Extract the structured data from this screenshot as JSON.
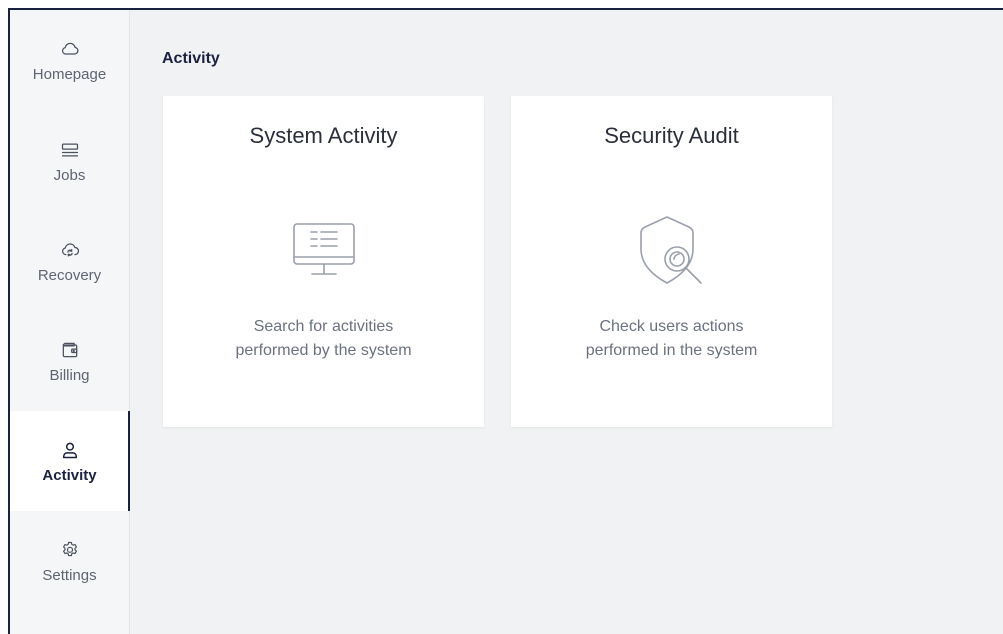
{
  "sidebar": {
    "items": [
      {
        "label": "Homepage",
        "icon": "cloud-icon"
      },
      {
        "label": "Jobs",
        "icon": "list-icon"
      },
      {
        "label": "Recovery",
        "icon": "cloud-refresh-icon"
      },
      {
        "label": "Billing",
        "icon": "wallet-icon"
      },
      {
        "label": "Activity",
        "icon": "user-icon",
        "active": true
      },
      {
        "label": "Settings",
        "icon": "gear-icon"
      }
    ]
  },
  "main": {
    "title": "Activity",
    "cards": [
      {
        "title": "System Activity",
        "description_line1": "Search for activities",
        "description_line2": "performed by the system",
        "icon": "monitor-list-icon"
      },
      {
        "title": "Security Audit",
        "description_line1": "Check users actions",
        "description_line2": "performed in the system",
        "icon": "shield-search-icon"
      }
    ]
  },
  "colors": {
    "accent": "#1b2140",
    "background": "#f1f2f3",
    "sidebar": "#f5f6f8",
    "icon_gray": "#9aa0aa"
  }
}
